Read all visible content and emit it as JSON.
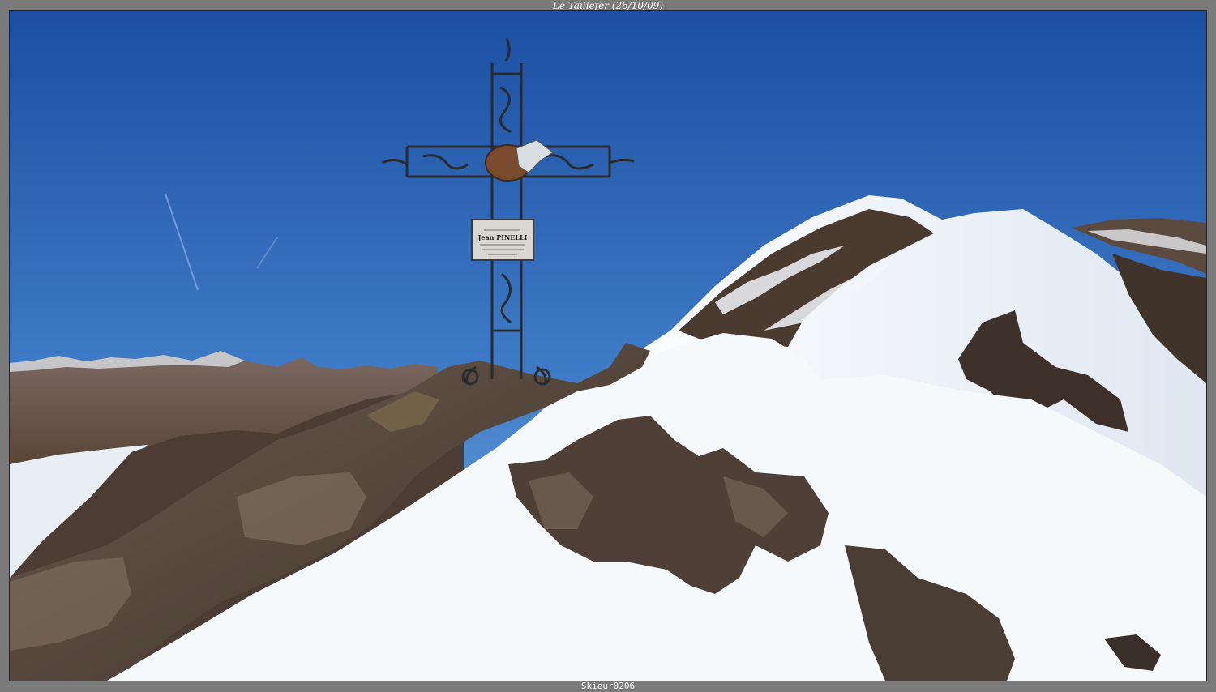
{
  "caption": {
    "title": "Le Taillefer (26/10/09)",
    "credit": "Skieur0206"
  },
  "plaque": {
    "line1": "Jean PINELLI"
  },
  "colors": {
    "frame": "#7a7a7a",
    "sky_top": "#1f55a9",
    "sky_bottom": "#6fa0d8",
    "snow": "#f4f7fb",
    "rock": "#5a4a3c"
  }
}
